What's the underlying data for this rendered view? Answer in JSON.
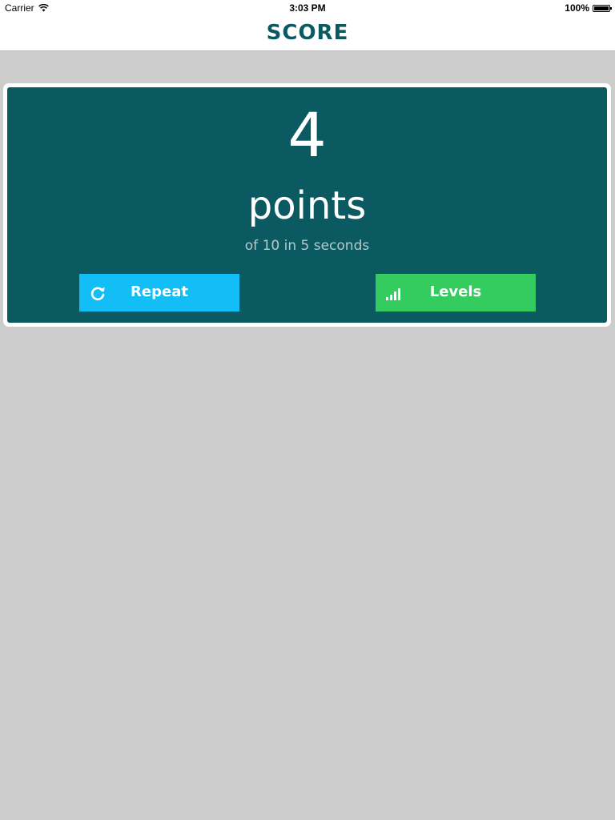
{
  "status_bar": {
    "carrier": "Carrier",
    "time": "3:03 PM",
    "battery": "100%"
  },
  "nav": {
    "title": "SCORE"
  },
  "score": {
    "value": "4",
    "unit": "points",
    "detail": "of 10 in 5 seconds"
  },
  "buttons": {
    "repeat_label": "Repeat",
    "repeat_icon": "refresh-icon",
    "levels_label": "Levels",
    "levels_icon": "signal-bars-icon"
  },
  "colors": {
    "background": "#cccccc",
    "card": "#0b5a62",
    "title": "#0b5a62",
    "repeat": "#12bef5",
    "levels": "#34cc5f"
  }
}
